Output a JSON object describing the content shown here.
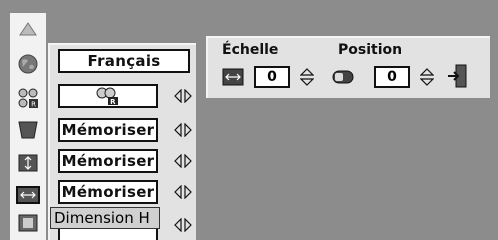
{
  "menu": {
    "language_label": "Français",
    "memory_items": [
      "Mémoriser",
      "Mémoriser",
      "Mémoriser"
    ],
    "tooltip": "Dimension H"
  },
  "adjust": {
    "scale_label": "Échelle",
    "position_label": "Position",
    "scale_value": "0",
    "position_value": "0"
  },
  "icons": [
    "up-arrow-icon",
    "globe-icon",
    "picture-mode-icon",
    "screen-shape-icon",
    "vertical-size-icon",
    "horizontal-size-icon",
    "fullscreen-icon",
    "scale-icon",
    "position-icon",
    "exit-icon"
  ]
}
